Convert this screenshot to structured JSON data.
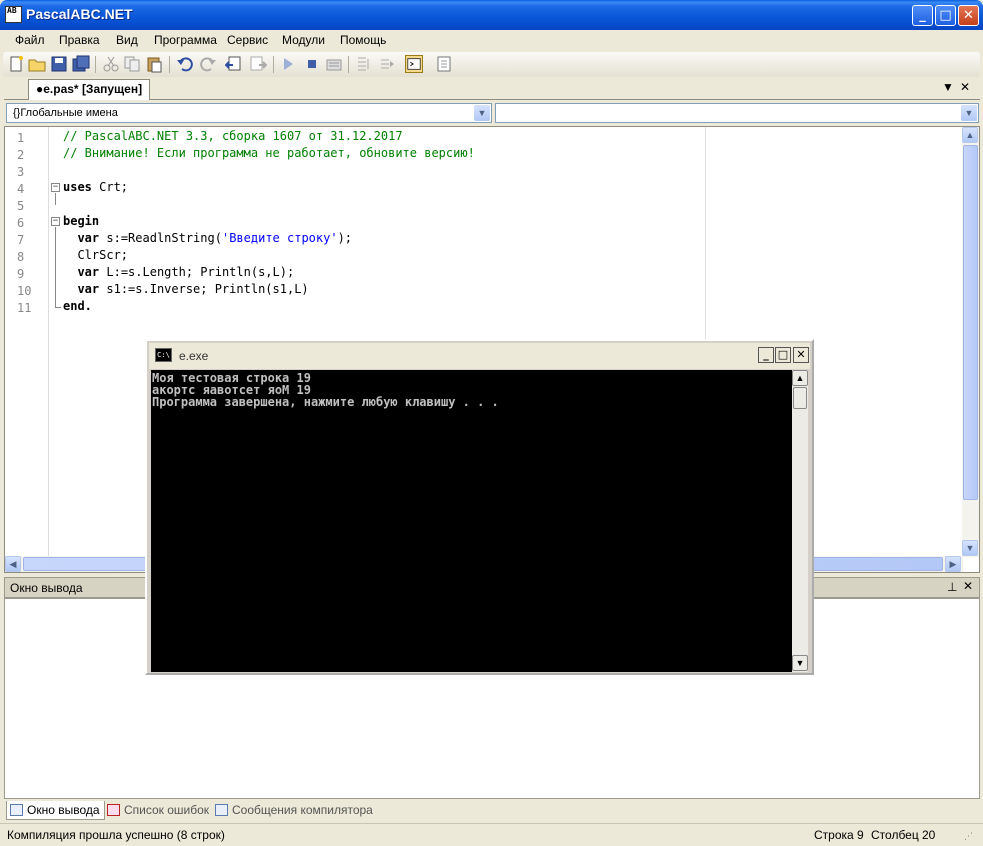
{
  "window": {
    "title": "PascalABC.NET",
    "icon_text": "AB"
  },
  "menu": [
    "Файл",
    "Правка",
    "Вид",
    "Программа",
    "Сервис",
    "Модули",
    "Помощь"
  ],
  "editor": {
    "tab_label": "●e.pas* [Запущен]",
    "scope_combo": "{}Глобальные имена",
    "member_combo": "",
    "line_numbers": [
      "1",
      "2",
      "3",
      "4",
      "5",
      "6",
      "7",
      "8",
      "9",
      "10",
      "11"
    ]
  },
  "output": {
    "title": "Окно вывода",
    "tabs": [
      "Окно вывода",
      "Список ошибок",
      "Сообщения компилятора"
    ]
  },
  "status": {
    "message": "Компиляция прошла успешно (8 строк)",
    "row_label": "Строка",
    "row": "9",
    "col_label": "Столбец",
    "col": "20"
  },
  "console": {
    "title": "e.exe",
    "lines": [
      "Моя тестовая строка 19",
      "акортс яавотсет яоМ 19",
      "Программа завершена, нажмите любую клавишу . . ."
    ]
  }
}
